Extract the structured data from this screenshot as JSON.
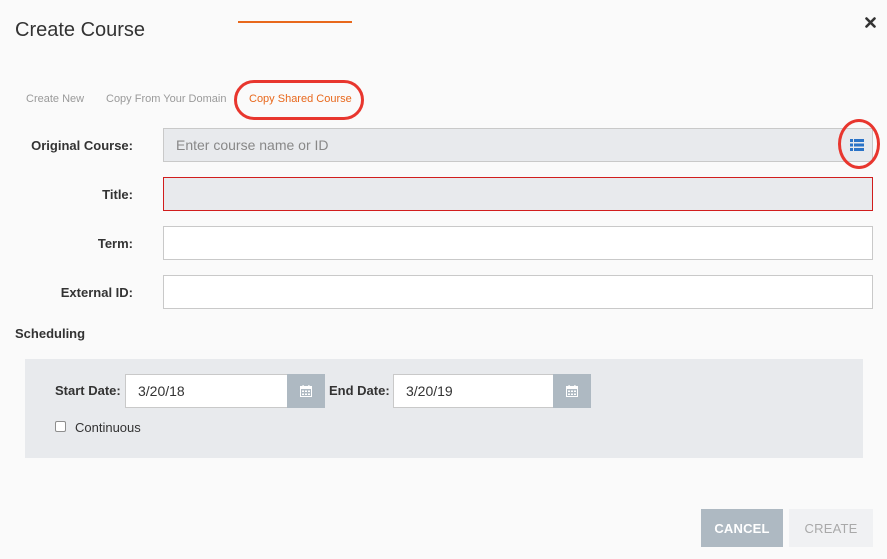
{
  "dialog": {
    "title": "Create Course",
    "close_icon": "close-icon"
  },
  "tabs": [
    {
      "label": "Create New",
      "active": false
    },
    {
      "label": "Copy From Your Domain",
      "active": false
    },
    {
      "label": "Copy Shared Course",
      "active": true
    }
  ],
  "form": {
    "original_course": {
      "label": "Original Course:",
      "value": "",
      "placeholder": "Enter course name or ID",
      "icon": "list-icon"
    },
    "title": {
      "label": "Title:",
      "value": "",
      "state": "error"
    },
    "term": {
      "label": "Term:",
      "value": ""
    },
    "external_id": {
      "label": "External ID:",
      "value": ""
    }
  },
  "scheduling": {
    "heading": "Scheduling",
    "start_date": {
      "label": "Start Date:",
      "value": "3/20/18",
      "icon": "calendar-icon"
    },
    "end_date": {
      "label": "End Date:",
      "value": "3/20/19",
      "icon": "calendar-icon"
    },
    "continuous": {
      "label": "Continuous",
      "checked": false
    }
  },
  "buttons": {
    "cancel": "CANCEL",
    "create": "CREATE"
  },
  "colors": {
    "accent": "#e8681c",
    "annotation": "#e8362e",
    "error_border": "#d11d1d",
    "icon_blue": "#2a73c7",
    "panel_bg": "#e8eaed",
    "button_grey": "#aeb9c2"
  }
}
